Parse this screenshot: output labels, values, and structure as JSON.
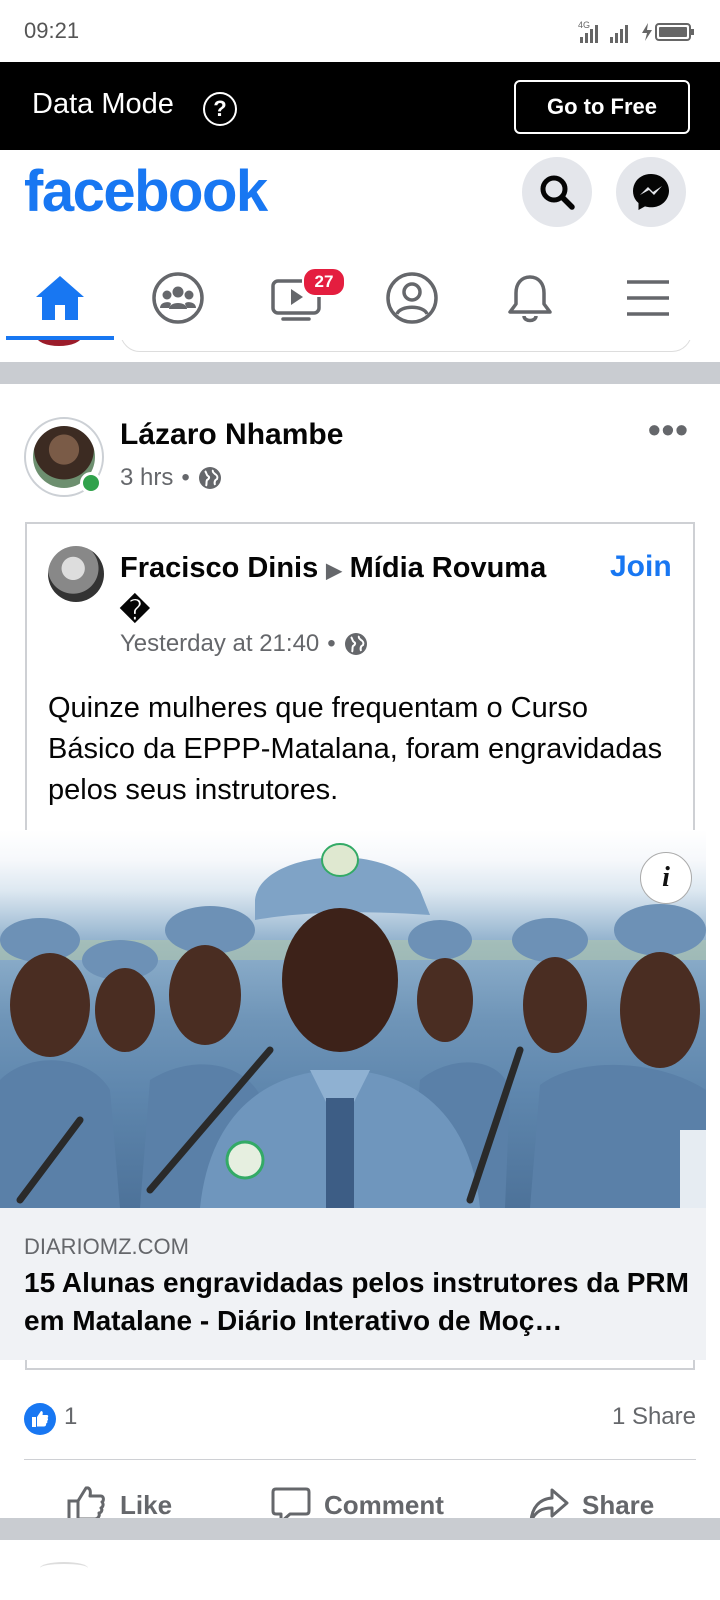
{
  "status_bar": {
    "time": "09:21",
    "network": "4G"
  },
  "data_banner": {
    "label": "Data Mode",
    "help_symbol": "?",
    "button": "Go to Free"
  },
  "header": {
    "logo": "facebook"
  },
  "nav": {
    "video_badge": "27"
  },
  "post": {
    "author": "Lázaro Nhambe",
    "time": "3 hrs",
    "separator": "•",
    "more_symbol": "•••",
    "shared": {
      "author": "Fracisco Dinis",
      "arrow": "▶",
      "group": "Mídia Rovuma",
      "extra_glyph": "�",
      "join": "Join",
      "time": "Yesterday at 21:40",
      "text": "Quinze mulheres que frequentam o Curso Básico da EPPP-Matalana, foram engravidadas pelos seus instrutores."
    },
    "link": {
      "info_symbol": "i",
      "domain": "DIARIOMZ.COM",
      "title": "15 Alunas engravidadas pelos instrutores da PRM em Matalane - Diário Interativo de Moç…"
    },
    "likes": "1",
    "shares": "1 Share",
    "actions": {
      "like": "Like",
      "comment": "Comment",
      "share": "Share"
    }
  },
  "colors": {
    "brand": "#1877f2",
    "badge": "#e41e3f",
    "online": "#31a24c",
    "secondary_text": "#65676b"
  }
}
